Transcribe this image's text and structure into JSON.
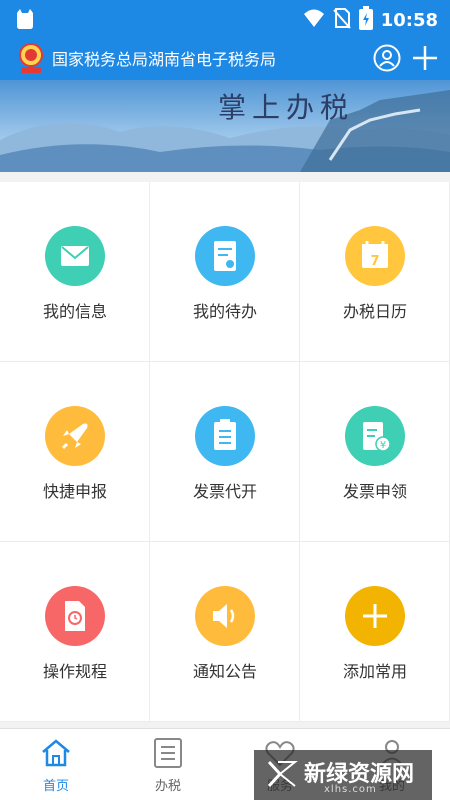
{
  "status_bar": {
    "time": "10:58",
    "icons": [
      "cat-icon",
      "wifi-icon",
      "no-sim-icon",
      "battery-icon"
    ]
  },
  "header": {
    "title": "国家税务总局湖南省电子税务局",
    "icons": [
      "emblem-icon",
      "user-icon",
      "plus-icon"
    ]
  },
  "banner": {
    "slogan": "掌上办税"
  },
  "grid": {
    "items": [
      {
        "label": "我的信息",
        "icon": "envelope-icon",
        "color": "#3ecfb4"
      },
      {
        "label": "我的待办",
        "icon": "document-edit-icon",
        "color": "#3fb7f0"
      },
      {
        "label": "办税日历",
        "icon": "calendar-icon",
        "color": "#ffc63e"
      },
      {
        "label": "快捷申报",
        "icon": "rocket-icon",
        "color": "#ffbc3c"
      },
      {
        "label": "发票代开",
        "icon": "checklist-icon",
        "color": "#3fb7f0"
      },
      {
        "label": "发票申领",
        "icon": "invoice-yen-icon",
        "color": "#3ecfb4"
      },
      {
        "label": "操作规程",
        "icon": "rules-document-icon",
        "color": "#f76767"
      },
      {
        "label": "通知公告",
        "icon": "speaker-icon",
        "color": "#ffbc3c"
      },
      {
        "label": "添加常用",
        "icon": "plus-icon",
        "color": "#f2b400"
      }
    ]
  },
  "tab_bar": {
    "tabs": [
      {
        "label": "首页",
        "icon": "home-icon",
        "active": true
      },
      {
        "label": "办税",
        "icon": "list-icon",
        "active": false
      },
      {
        "label": "服务",
        "icon": "heart-icon",
        "active": false
      },
      {
        "label": "我的",
        "icon": "person-icon",
        "active": false
      }
    ]
  },
  "watermark": {
    "text": "新绿资源网",
    "sub": "xlhs.com"
  },
  "colors": {
    "primary": "#1e88e5"
  }
}
